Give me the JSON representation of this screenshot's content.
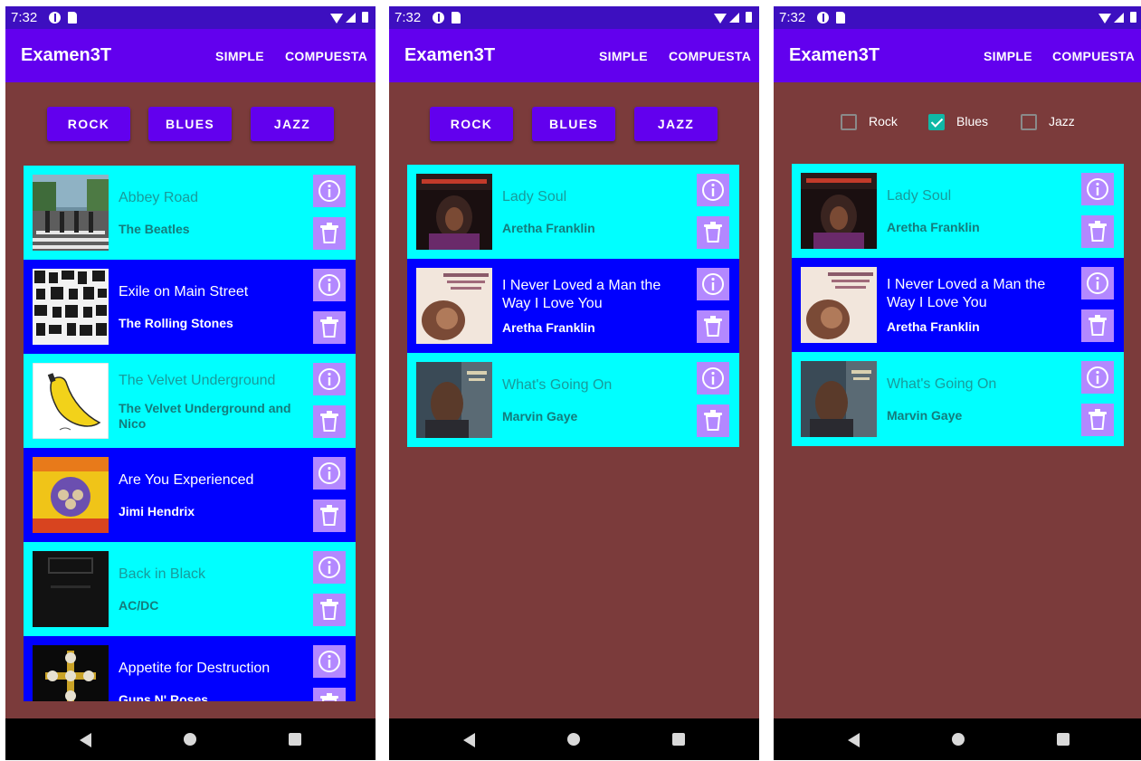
{
  "status_bar": {
    "time": "7:32"
  },
  "app": {
    "title": "Examen3T",
    "menu_simple": "SIMPLE",
    "menu_compuesta": "COMPUESTA"
  },
  "colors": {
    "statusbar": "#3d0fc0",
    "appbar": "#6200ee",
    "background": "#7b3b3b",
    "row_cyan": "#00ffff",
    "row_blue": "#0000ff",
    "action_button": "#b388ff",
    "checkbox_checked": "#0fb8a6"
  },
  "icons": {
    "info": "info-icon",
    "delete": "trash-icon"
  },
  "screen1": {
    "buttons": {
      "rock": "ROCK",
      "blues": "BLUES",
      "jazz": "JAZZ"
    },
    "albums": [
      {
        "title": "Abbey Road",
        "artist": "The Beatles"
      },
      {
        "title": "Exile on Main Street",
        "artist": "The Rolling Stones"
      },
      {
        "title": "The Velvet Underground",
        "artist": "The Velvet Underground and Nico"
      },
      {
        "title": "Are You Experienced",
        "artist": "Jimi Hendrix"
      },
      {
        "title": "Back in Black",
        "artist": "AC/DC"
      },
      {
        "title": "Appetite for Destruction",
        "artist": "Guns N' Roses"
      }
    ]
  },
  "screen2": {
    "buttons": {
      "rock": "ROCK",
      "blues": "BLUES",
      "jazz": "JAZZ"
    },
    "albums": [
      {
        "title": "Lady Soul",
        "artist": "Aretha Franklin"
      },
      {
        "title": "I Never Loved a Man the Way I Love You",
        "artist": "Aretha Franklin"
      },
      {
        "title": "What's Going On",
        "artist": "Marvin Gaye"
      }
    ]
  },
  "screen3": {
    "checkboxes": [
      {
        "label": "Rock",
        "checked": false
      },
      {
        "label": "Blues",
        "checked": true
      },
      {
        "label": "Jazz",
        "checked": false
      }
    ],
    "albums": [
      {
        "title": "Lady Soul",
        "artist": "Aretha Franklin"
      },
      {
        "title": "I Never Loved a Man the Way I Love You",
        "artist": "Aretha Franklin"
      },
      {
        "title": "What's Going On",
        "artist": "Marvin Gaye"
      }
    ]
  }
}
